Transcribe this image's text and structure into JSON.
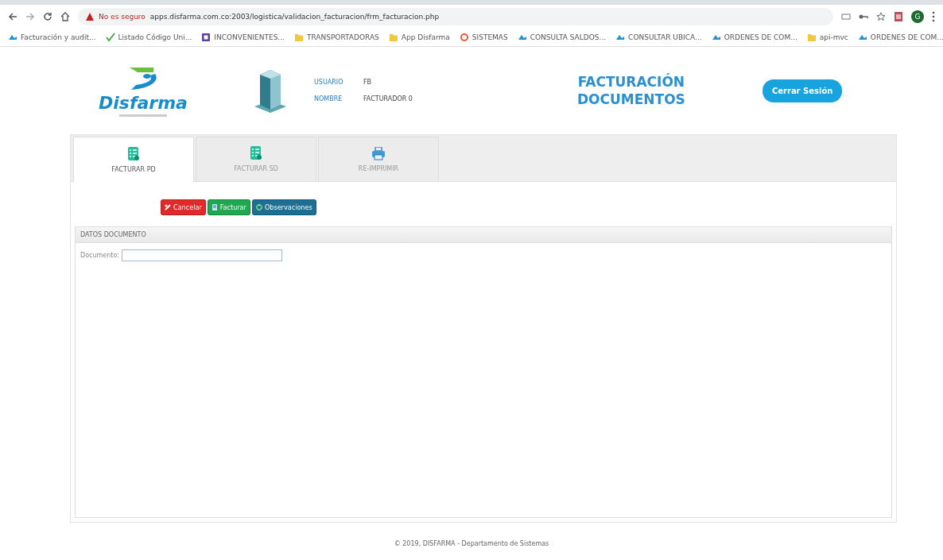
{
  "browser": {
    "security_label": "No es seguro",
    "url": "apps.disfarma.com.co:2003/logistica/validacion_facturacion/frm_facturacion.php",
    "account_initial": "G",
    "bookmarks": [
      {
        "label": "Facturación y audit...",
        "kind": "site"
      },
      {
        "label": "Listado Código Uni...",
        "kind": "check"
      },
      {
        "label": "INCONVENIENTES...",
        "kind": "app"
      },
      {
        "label": "TRANSPORTADORAS",
        "kind": "folder"
      },
      {
        "label": "App Disfarma",
        "kind": "folder"
      },
      {
        "label": "SISTEMAS",
        "kind": "ring"
      },
      {
        "label": "CONSULTA SALDOS...",
        "kind": "site"
      },
      {
        "label": "CONSULTAR UBICA...",
        "kind": "site"
      },
      {
        "label": "ORDENES DE COM...",
        "kind": "site"
      },
      {
        "label": "api-mvc",
        "kind": "folder"
      },
      {
        "label": "ORDENES DE COM...",
        "kind": "site"
      }
    ]
  },
  "header": {
    "logo": "Disfarma",
    "user_fields": [
      {
        "label": "USUARIO",
        "value": "FB"
      },
      {
        "label": "NOMBRE",
        "value": "FACTURADOR 0"
      }
    ],
    "title_lines": [
      "FACTURACIÓN",
      "DOCUMENTOS"
    ],
    "logout": "Cerrar Sesión"
  },
  "tabs": [
    {
      "label": "FACTURAR PD",
      "selected": true,
      "kind": "list"
    },
    {
      "label": "FACTURAR SD",
      "selected": false,
      "kind": "list"
    },
    {
      "label": "RE-IMPRIMIR",
      "selected": false,
      "kind": "printer"
    }
  ],
  "actions": [
    {
      "label": "Cancelar",
      "kind": "danger"
    },
    {
      "label": "Facturar",
      "kind": "success"
    },
    {
      "label": "Observaciones",
      "kind": "info"
    }
  ],
  "panel": {
    "title": "DATOS DOCUMENTO",
    "field_label": "Documento:"
  },
  "footer": "© 2019, DISFARMA - Departamento de Sistemas"
}
